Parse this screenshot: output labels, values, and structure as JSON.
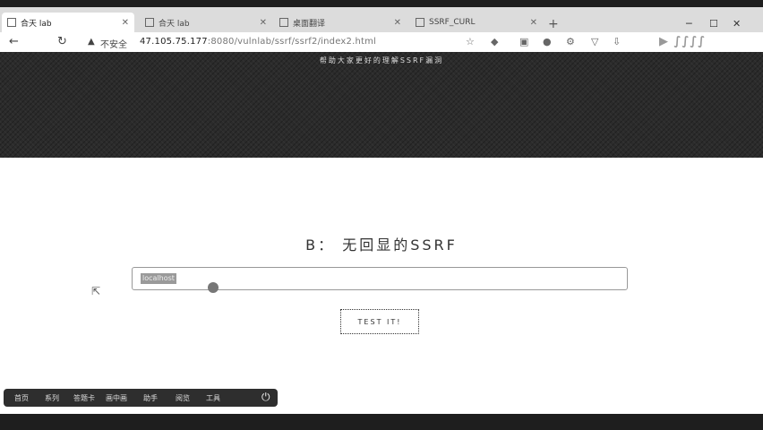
{
  "tabs": [
    {
      "label": "合天 lab",
      "active": true
    },
    {
      "label": "合天 lab",
      "active": false
    },
    {
      "label": "桌面翻译",
      "active": false
    },
    {
      "label": "SSRF_CURL",
      "active": false
    }
  ],
  "address": {
    "insecure_label": "不安全",
    "url_host": "47.105.75.177",
    "url_path": ":8080/vulnlab/ssrf/ssrf2/index2.html"
  },
  "hero": {
    "subtitle": "帮助大家更好的理解SSRF漏洞"
  },
  "main": {
    "heading": "B： 无回显的SSRF",
    "input_value": "localhost",
    "test_button": "TEST IT!"
  },
  "taskbar": {
    "items": [
      "首页",
      "系列",
      "答题卡",
      "画中画",
      "助手",
      "阅览",
      "工具"
    ]
  }
}
